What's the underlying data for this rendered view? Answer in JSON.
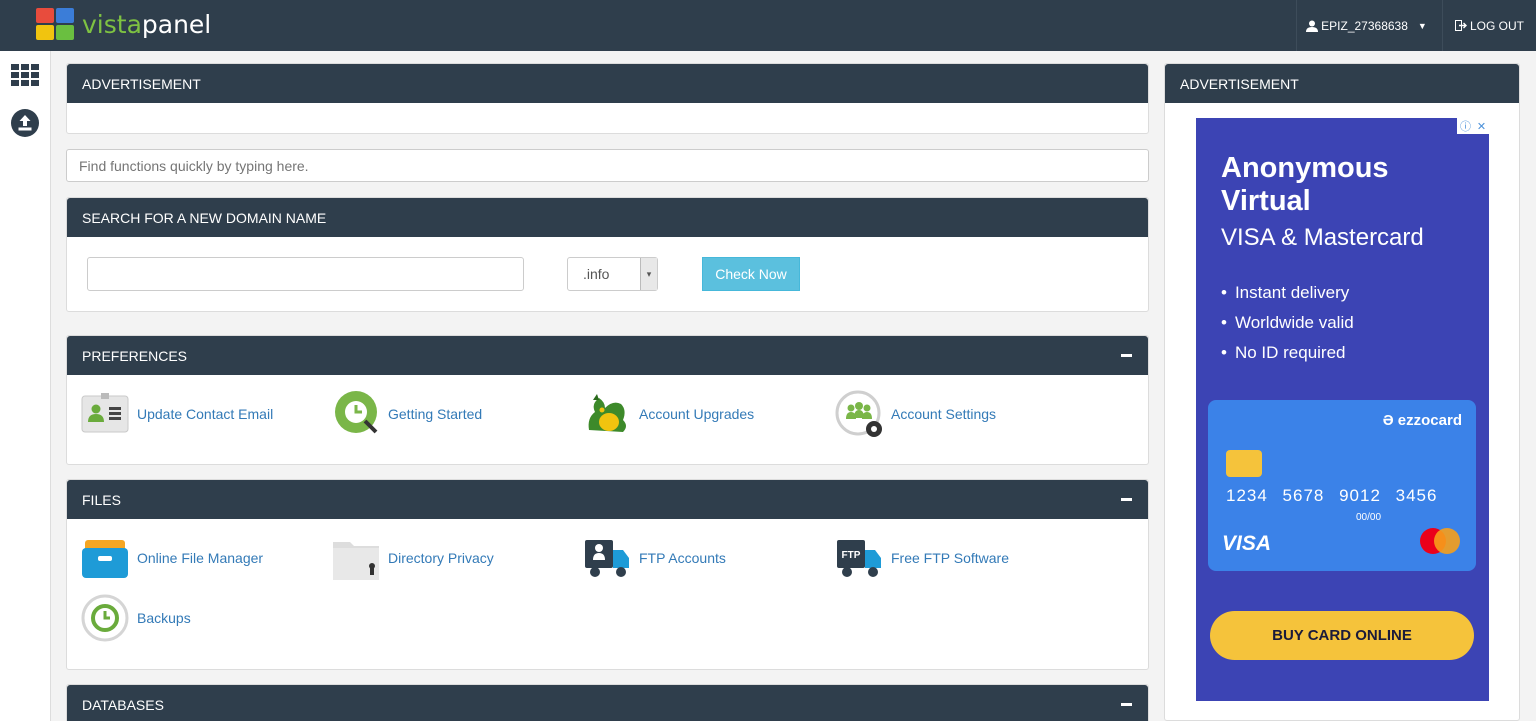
{
  "brand": {
    "logo_prefix": "vista",
    "logo_suffix": "panel"
  },
  "topbar": {
    "username": "EPIZ_27368638",
    "logout_label": "LOG OUT"
  },
  "ad_left": {
    "title": "ADVERTISEMENT"
  },
  "search": {
    "placeholder": "Find functions quickly by typing here."
  },
  "domain_search": {
    "title": "SEARCH FOR A NEW DOMAIN NAME",
    "domain_value": "",
    "tld_selected": ".info",
    "button_label": "Check Now"
  },
  "preferences": {
    "title": "PREFERENCES",
    "items": [
      {
        "label": "Update Contact Email",
        "icon": "contact-card-icon"
      },
      {
        "label": "Getting Started",
        "icon": "clock-magnifier-icon"
      },
      {
        "label": "Account Upgrades",
        "icon": "dragon-icon"
      },
      {
        "label": "Account Settings",
        "icon": "users-gear-icon"
      }
    ]
  },
  "files": {
    "title": "FILES",
    "items": [
      {
        "label": "Online File Manager",
        "icon": "file-drawer-icon"
      },
      {
        "label": "Directory Privacy",
        "icon": "locked-folder-icon"
      },
      {
        "label": "FTP Accounts",
        "icon": "ftp-truck-user-icon"
      },
      {
        "label": "Free FTP Software",
        "icon": "ftp-truck-icon"
      },
      {
        "label": "Backups",
        "icon": "backup-clock-icon"
      }
    ]
  },
  "databases": {
    "title": "DATABASES"
  },
  "ad_right": {
    "title": "ADVERTISEMENT",
    "headline": "Anonymous Virtual",
    "subheadline": "VISA & Mastercard",
    "bullets": [
      "Instant delivery",
      "Worldwide valid",
      "No ID required"
    ],
    "card_brand": "ezzocard",
    "card_number": "1234 5678 9012 3456",
    "card_expiry": "00/00",
    "card_network": "VISA",
    "cta": "BUY CARD ONLINE"
  },
  "colors": {
    "topbar": "#2f3e4c",
    "panel_header": "#2f3e4c",
    "link": "#337ab7",
    "check_button": "#5bc0de",
    "ad_background": "#3c44b4",
    "cta_button": "#f5c33b"
  }
}
